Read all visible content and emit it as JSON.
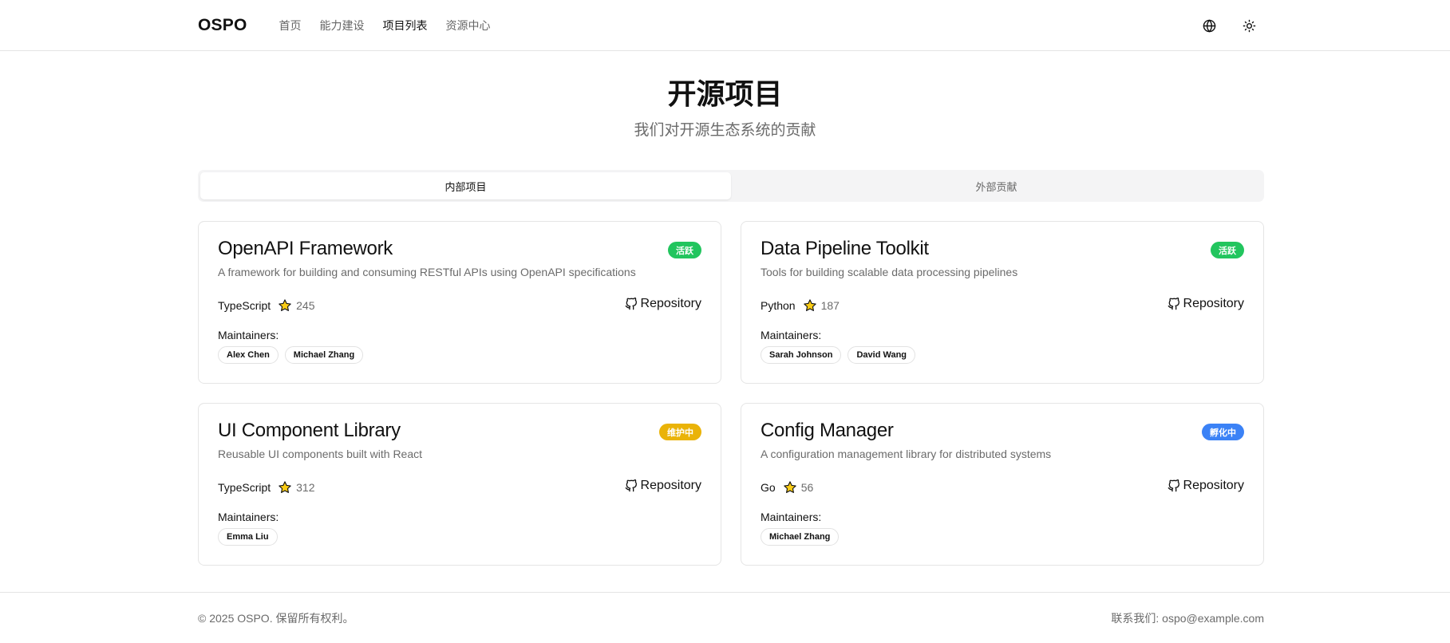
{
  "header": {
    "logo": "OSPO",
    "nav": [
      "首页",
      "能力建设",
      "项目列表",
      "资源中心"
    ],
    "active_nav_index": 2,
    "icons": [
      "globe-icon",
      "sun-icon"
    ]
  },
  "hero": {
    "title": "开源项目",
    "subtitle": "我们对开源生态系统的贡献"
  },
  "tabs": {
    "items": [
      "内部项目",
      "外部贡献"
    ],
    "active_index": 0
  },
  "projects": [
    {
      "name": "OpenAPI Framework",
      "description": "A framework for building and consuming RESTful APIs using OpenAPI specifications",
      "status": "活跃",
      "status_color": "#22c55e",
      "language": "TypeScript",
      "stars": "245",
      "repo_label": "Repository",
      "maintainers_label": "Maintainers:",
      "maintainers": [
        "Alex Chen",
        "Michael Zhang"
      ]
    },
    {
      "name": "Data Pipeline Toolkit",
      "description": "Tools for building scalable data processing pipelines",
      "status": "活跃",
      "status_color": "#22c55e",
      "language": "Python",
      "stars": "187",
      "repo_label": "Repository",
      "maintainers_label": "Maintainers:",
      "maintainers": [
        "Sarah Johnson",
        "David Wang"
      ]
    },
    {
      "name": "UI Component Library",
      "description": "Reusable UI components built with React",
      "status": "维护中",
      "status_color": "#eab308",
      "language": "TypeScript",
      "stars": "312",
      "repo_label": "Repository",
      "maintainers_label": "Maintainers:",
      "maintainers": [
        "Emma Liu"
      ]
    },
    {
      "name": "Config Manager",
      "description": "A configuration management library for distributed systems",
      "status": "孵化中",
      "status_color": "#3b82f6",
      "language": "Go",
      "stars": "56",
      "repo_label": "Repository",
      "maintainers_label": "Maintainers:",
      "maintainers": [
        "Michael Zhang"
      ]
    }
  ],
  "footer": {
    "copyright": "© 2025 OSPO. 保留所有权利。",
    "contact": "联系我们: ospo@example.com"
  },
  "colors": {
    "star": "#facc15",
    "border": "#e5e5e5",
    "muted_text": "#6b6b6b"
  }
}
